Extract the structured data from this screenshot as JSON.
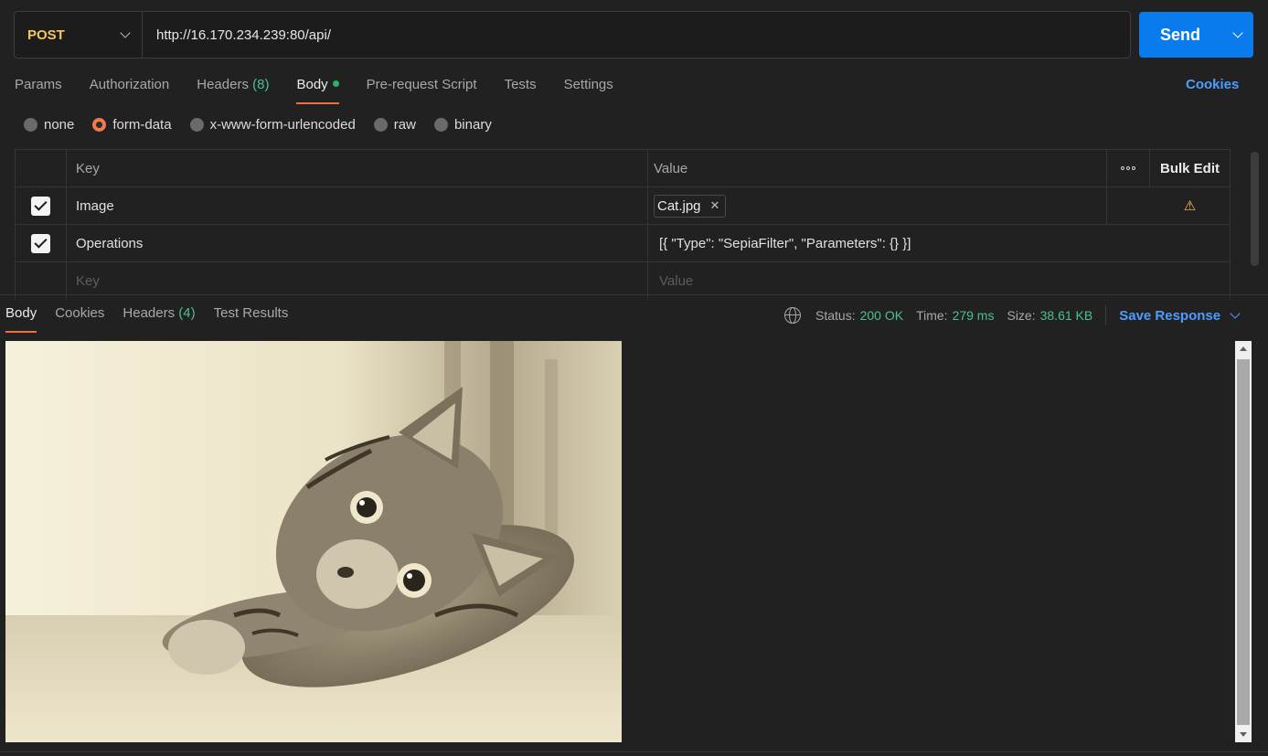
{
  "request": {
    "method": "POST",
    "url": "http://16.170.234.239:80/api/",
    "send_label": "Send"
  },
  "request_tabs": [
    {
      "label": "Params"
    },
    {
      "label": "Authorization"
    },
    {
      "label": "Headers",
      "count": "(8)"
    },
    {
      "label": "Body",
      "active": true
    },
    {
      "label": "Pre-request Script"
    },
    {
      "label": "Tests"
    },
    {
      "label": "Settings"
    }
  ],
  "cookies_link": "Cookies",
  "body_types": [
    "none",
    "form-data",
    "x-www-form-urlencoded",
    "raw",
    "binary"
  ],
  "body_selected": "form-data",
  "form_table": {
    "headers": {
      "key": "Key",
      "value": "Value",
      "bulk_edit": "Bulk Edit"
    },
    "rows": [
      {
        "checked": true,
        "key": "Image",
        "value_file": "Cat.jpg",
        "warning": true
      },
      {
        "checked": true,
        "key": "Operations",
        "value": "[{ \"Type\": \"SepiaFilter\", \"Parameters\": {} }]"
      }
    ],
    "placeholder": {
      "key": "Key",
      "value": "Value"
    }
  },
  "response": {
    "tabs": [
      {
        "label": "Body",
        "active": true
      },
      {
        "label": "Cookies"
      },
      {
        "label": "Headers",
        "count": "(4)"
      },
      {
        "label": "Test Results"
      }
    ],
    "status_label": "Status:",
    "status": "200 OK",
    "time_label": "Time:",
    "time": "279 ms",
    "size_label": "Size:",
    "size": "38.61 KB",
    "save_label": "Save Response"
  },
  "colors": {
    "accent": "#097bed",
    "method": "#f4c65c",
    "success": "#49c28b",
    "active_tab": "#f36c3d"
  },
  "icons": [
    "chevron-down-icon",
    "globe-icon",
    "warning-icon",
    "close-icon",
    "more-icon"
  ]
}
